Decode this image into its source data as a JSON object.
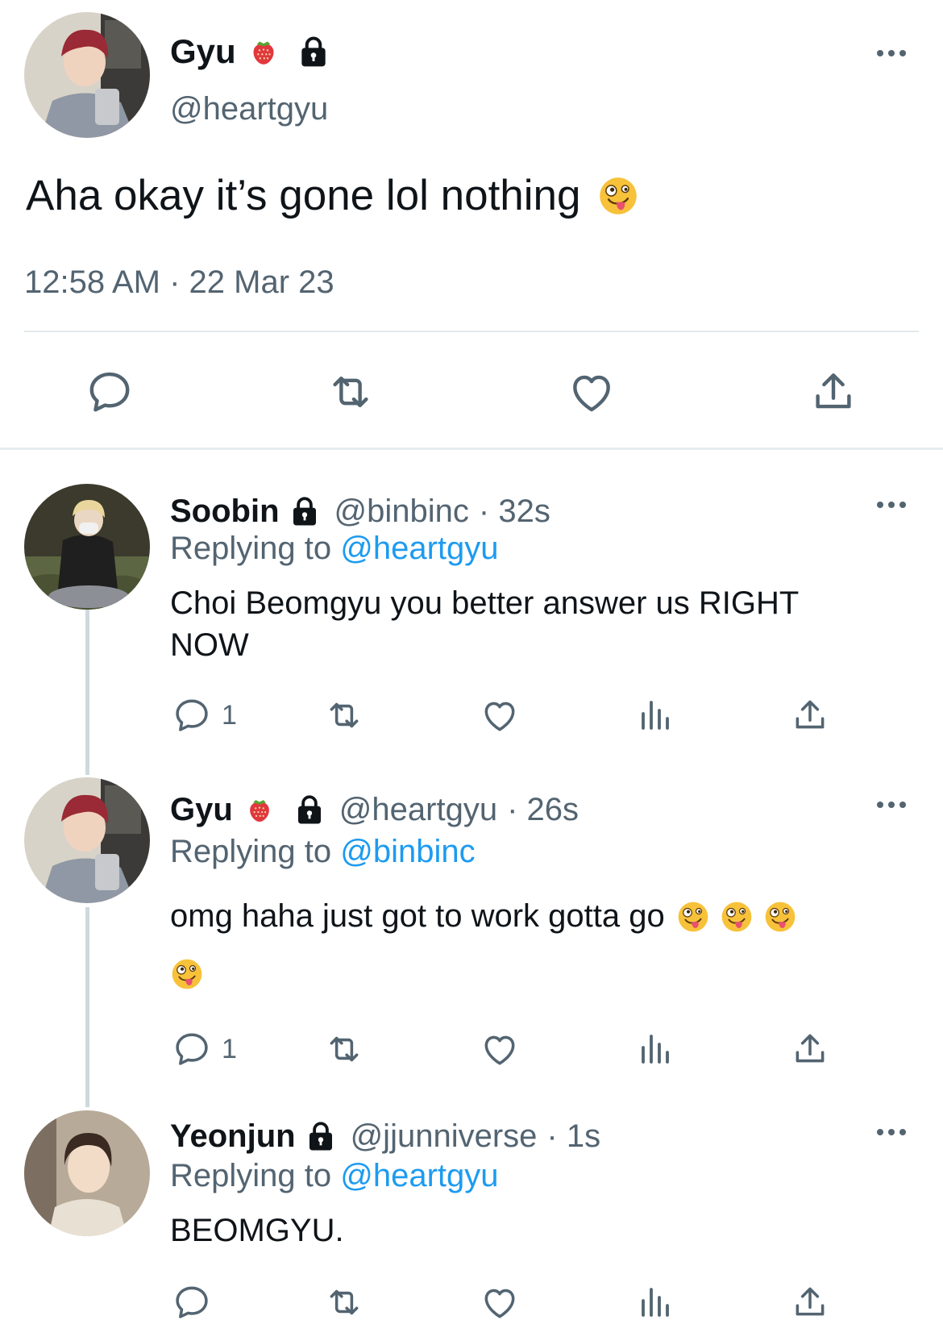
{
  "main_tweet": {
    "display_name": "Gyu",
    "handle": "@heartgyu",
    "text": "Aha okay it’s gone lol nothing",
    "timestamp": "12:58 AM · 22 Mar 23",
    "name_emojis": [
      "strawberry-icon",
      "lock-icon"
    ],
    "text_emoji": "zany-face-icon"
  },
  "replies": [
    {
      "display_name": "Soobin",
      "handle": "@binbinc",
      "time": "· 32s",
      "replying_prefix": "Replying to ",
      "replying_to": "@heartgyu",
      "text_line1": "Choi Beomgyu you better answer us RIGHT",
      "text_line2": "NOW",
      "reply_count": "1"
    },
    {
      "display_name": "Gyu",
      "handle": "@heartgyu",
      "time": "· 26s",
      "replying_prefix": "Replying to ",
      "replying_to": "@binbinc",
      "text": "omg haha just got to work gotta go",
      "reply_count": "1"
    },
    {
      "display_name": "Yeonjun",
      "handle": "@jjunniverse",
      "time": "· 1s",
      "replying_prefix": "Replying to ",
      "replying_to": "@heartgyu",
      "text": "BEOMGYU.",
      "reply_count": ""
    }
  ],
  "colors": {
    "text": "#0f1419",
    "muted": "#536471",
    "link": "#1d9bf0",
    "divider": "#cfd9de"
  }
}
